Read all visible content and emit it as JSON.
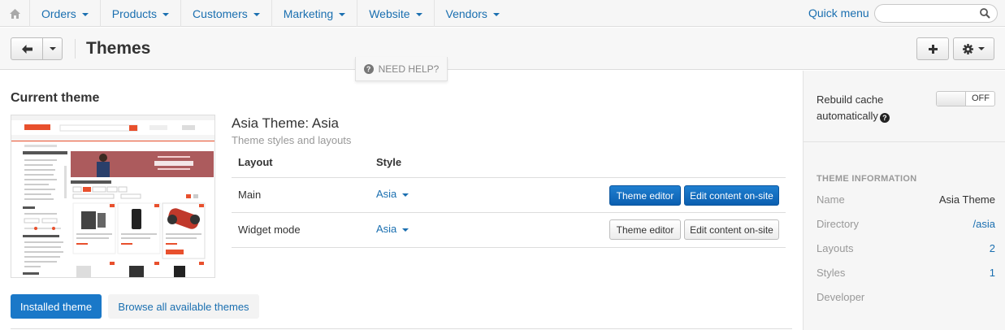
{
  "nav": {
    "items": [
      "Orders",
      "Products",
      "Customers",
      "Marketing",
      "Website",
      "Vendors"
    ],
    "quick_menu": "Quick menu",
    "search_placeholder": ""
  },
  "header": {
    "title": "Themes",
    "help": "NEED HELP?"
  },
  "main": {
    "section_title": "Current theme",
    "theme_name": "Asia Theme: Asia",
    "theme_subtitle": "Theme styles and layouts",
    "columns": [
      "Layout",
      "Style"
    ],
    "rows": [
      {
        "layout": "Main",
        "style": "Asia",
        "editor": "Theme editor",
        "onsite": "Edit content on-site"
      },
      {
        "layout": "Widget mode",
        "style": "Asia",
        "editor": "Theme editor",
        "onsite": "Edit content on-site"
      }
    ],
    "tabs": {
      "installed": "Installed theme",
      "browse": "Browse all available themes"
    }
  },
  "sidebar": {
    "rebuild_label": "Rebuild cache automatically",
    "toggle_state": "OFF",
    "info_heading": "THEME INFORMATION",
    "info": [
      {
        "key": "Name",
        "value": "Asia Theme"
      },
      {
        "key": "Directory",
        "value": "/asia"
      },
      {
        "key": "Layouts",
        "value": "2"
      },
      {
        "key": "Styles",
        "value": "1"
      },
      {
        "key": "Developer",
        "value": ""
      }
    ]
  },
  "colors": {
    "link": "#1a6fb0",
    "primary": "#1a78c8",
    "accent": "#e8502d"
  }
}
